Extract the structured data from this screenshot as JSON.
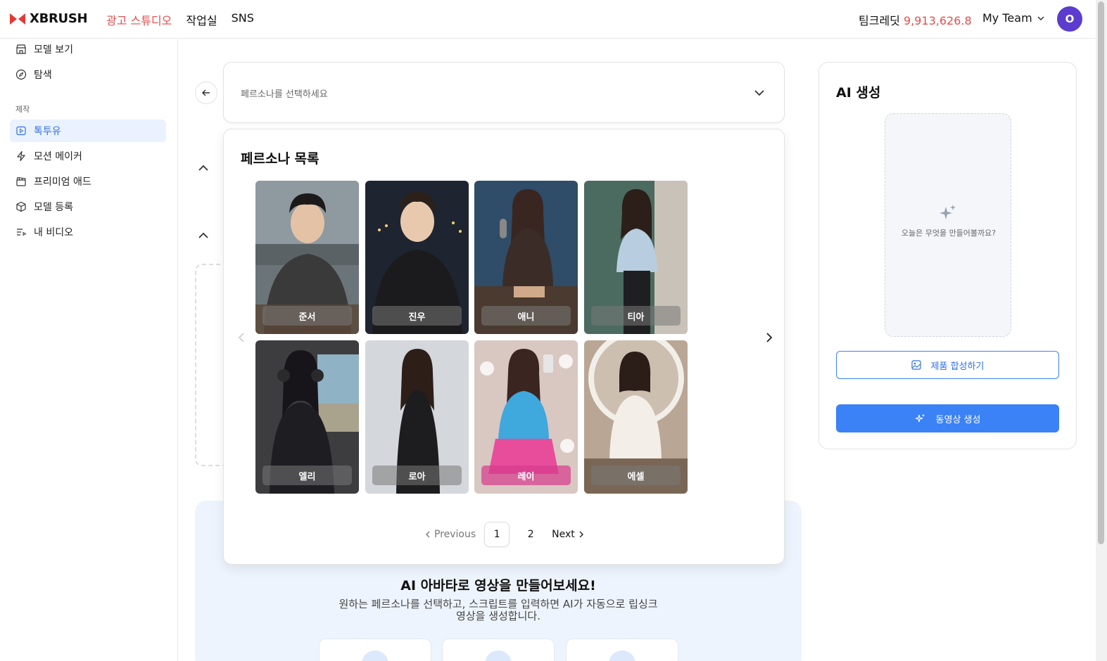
{
  "app": {
    "name": "XBRUSH",
    "brand_color": "#ea4b4b",
    "accent_color": "#3b82f6"
  },
  "topnav": [
    {
      "label": "광고 스튜디오",
      "active": true
    },
    {
      "label": "작업실",
      "active": false
    },
    {
      "label": "SNS",
      "active": false
    }
  ],
  "header": {
    "credit_label": "팀크레딧",
    "credit_value": "9,913,626.8",
    "team_label": "My Team",
    "avatar_initial": "O"
  },
  "sidebar": {
    "items_top": [
      {
        "label": "모델 보기",
        "icon": "store-icon"
      },
      {
        "label": "탐색",
        "icon": "compass-icon"
      }
    ],
    "section_label": "제작",
    "items_make": [
      {
        "label": "톡투유",
        "icon": "video-play-icon",
        "active": true
      },
      {
        "label": "모션 메이커",
        "icon": "lightning-icon",
        "active": false
      },
      {
        "label": "프리미엄 애드",
        "icon": "clapperboard-icon",
        "active": false
      },
      {
        "label": "모델 등록",
        "icon": "box-icon",
        "active": false
      },
      {
        "label": "내 비디오",
        "icon": "list-video-icon",
        "active": false
      }
    ]
  },
  "persona_select": {
    "placeholder": "페르소나를 선택하세요",
    "list_title": "페르소나 목록",
    "personas": [
      {
        "name": "준서"
      },
      {
        "name": "진우"
      },
      {
        "name": "애니"
      },
      {
        "name": "티아"
      },
      {
        "name": "엘리"
      },
      {
        "name": "로아"
      },
      {
        "name": "레이"
      },
      {
        "name": "에셀"
      }
    ],
    "pager": {
      "previous": "Previous",
      "pages": [
        "1",
        "2"
      ],
      "current": "1",
      "next": "Next"
    }
  },
  "promo": {
    "title": "AI 아바타로 영상을 만들어보세요!",
    "description": "원하는 페르소나를 선택하고, 스크립트를 입력하면 AI가 자동으로 립싱크 영상을 생성합니다."
  },
  "ai_panel": {
    "title": "AI 생성",
    "placeholder_text": "오늘은 무엇을 만들어볼까요?",
    "compose_button": "제품 합성하기",
    "generate_button": "동영상 생성"
  }
}
